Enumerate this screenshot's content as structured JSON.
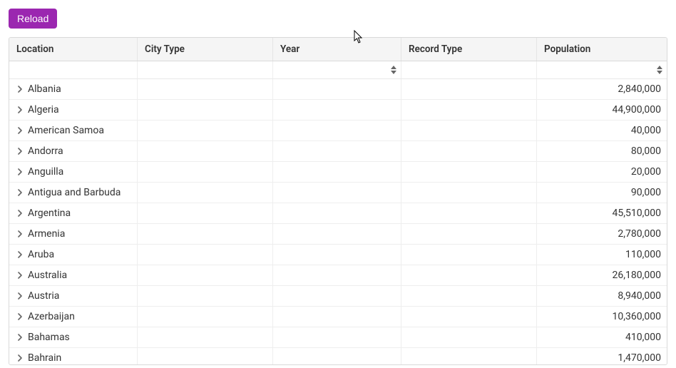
{
  "toolbar": {
    "reload_label": "Reload"
  },
  "columns": {
    "location": "Location",
    "city_type": "City Type",
    "year": "Year",
    "record_type": "Record Type",
    "population": "Population"
  },
  "filters": {
    "location": "",
    "city_type": "",
    "year": "",
    "record_type": "",
    "population": ""
  },
  "rows": [
    {
      "location": "Albania",
      "city_type": "",
      "year": "",
      "record_type": "",
      "population": "2,840,000"
    },
    {
      "location": "Algeria",
      "city_type": "",
      "year": "",
      "record_type": "",
      "population": "44,900,000"
    },
    {
      "location": "American Samoa",
      "city_type": "",
      "year": "",
      "record_type": "",
      "population": "40,000"
    },
    {
      "location": "Andorra",
      "city_type": "",
      "year": "",
      "record_type": "",
      "population": "80,000"
    },
    {
      "location": "Anguilla",
      "city_type": "",
      "year": "",
      "record_type": "",
      "population": "20,000"
    },
    {
      "location": "Antigua and Barbuda",
      "city_type": "",
      "year": "",
      "record_type": "",
      "population": "90,000"
    },
    {
      "location": "Argentina",
      "city_type": "",
      "year": "",
      "record_type": "",
      "population": "45,510,000"
    },
    {
      "location": "Armenia",
      "city_type": "",
      "year": "",
      "record_type": "",
      "population": "2,780,000"
    },
    {
      "location": "Aruba",
      "city_type": "",
      "year": "",
      "record_type": "",
      "population": "110,000"
    },
    {
      "location": "Australia",
      "city_type": "",
      "year": "",
      "record_type": "",
      "population": "26,180,000"
    },
    {
      "location": "Austria",
      "city_type": "",
      "year": "",
      "record_type": "",
      "population": "8,940,000"
    },
    {
      "location": "Azerbaijan",
      "city_type": "",
      "year": "",
      "record_type": "",
      "population": "10,360,000"
    },
    {
      "location": "Bahamas",
      "city_type": "",
      "year": "",
      "record_type": "",
      "population": "410,000"
    },
    {
      "location": "Bahrain",
      "city_type": "",
      "year": "",
      "record_type": "",
      "population": "1,470,000"
    }
  ]
}
